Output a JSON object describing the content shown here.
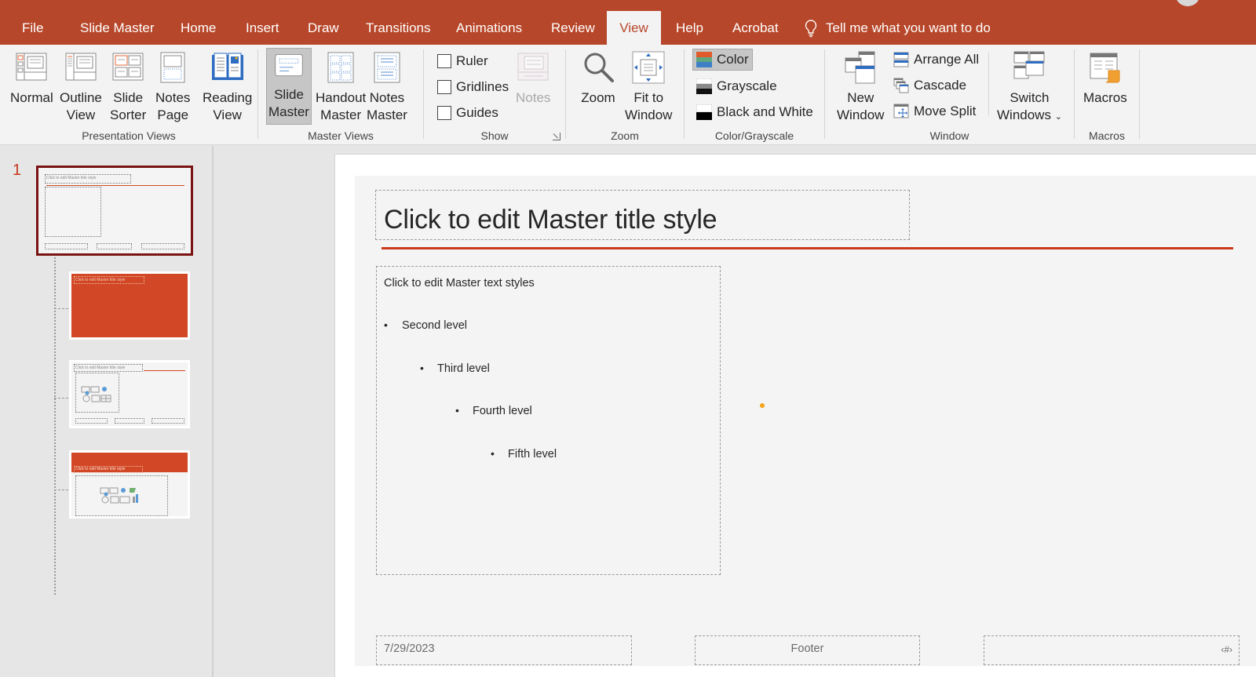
{
  "tabs": [
    {
      "label": "File"
    },
    {
      "label": "Slide Master"
    },
    {
      "label": "Home"
    },
    {
      "label": "Insert"
    },
    {
      "label": "Draw"
    },
    {
      "label": "Transitions"
    },
    {
      "label": "Animations"
    },
    {
      "label": "Review"
    },
    {
      "label": "View",
      "active": true
    },
    {
      "label": "Help"
    },
    {
      "label": "Acrobat"
    }
  ],
  "tell_me": {
    "placeholder": "Tell me what you want to do",
    "icon": "lightbulb-icon"
  },
  "ribbon": {
    "presentation_views": {
      "label": "Presentation Views",
      "buttons": [
        {
          "line1": "Normal",
          "line2": "",
          "icon": "normal-view-icon"
        },
        {
          "line1": "Outline",
          "line2": "View",
          "icon": "outline-view-icon"
        },
        {
          "line1": "Slide",
          "line2": "Sorter",
          "icon": "slide-sorter-icon"
        },
        {
          "line1": "Notes",
          "line2": "Page",
          "icon": "notes-page-icon"
        },
        {
          "line1": "Reading",
          "line2": "View",
          "icon": "reading-view-icon"
        }
      ]
    },
    "master_views": {
      "label": "Master Views",
      "buttons": [
        {
          "line1": "Slide",
          "line2": "Master",
          "icon": "slide-master-icon",
          "selected": true
        },
        {
          "line1": "Handout",
          "line2": "Master",
          "icon": "handout-master-icon"
        },
        {
          "line1": "Notes",
          "line2": "Master",
          "icon": "notes-master-icon"
        }
      ]
    },
    "show": {
      "label": "Show",
      "checkboxes": [
        {
          "label": "Ruler",
          "checked": false
        },
        {
          "label": "Gridlines",
          "checked": false
        },
        {
          "label": "Guides",
          "checked": false
        }
      ],
      "notes_button": {
        "label": "Notes",
        "disabled": true
      }
    },
    "zoom": {
      "label": "Zoom",
      "buttons": [
        {
          "line1": "Zoom",
          "line2": "",
          "icon": "magnifier-icon"
        },
        {
          "line1": "Fit to",
          "line2": "Window",
          "icon": "fit-to-window-icon"
        }
      ]
    },
    "color_grayscale": {
      "label": "Color/Grayscale",
      "options": [
        {
          "label": "Color",
          "selected": true
        },
        {
          "label": "Grayscale",
          "selected": false
        },
        {
          "label": "Black and White",
          "selected": false
        }
      ]
    },
    "window": {
      "label": "Window",
      "new_window": {
        "line1": "New",
        "line2": "Window"
      },
      "small": [
        {
          "label": "Arrange All"
        },
        {
          "label": "Cascade"
        },
        {
          "label": "Move Split"
        }
      ],
      "switch_windows": {
        "line1": "Switch",
        "line2": "Windows",
        "dropdown": "⌄"
      }
    },
    "macros": {
      "label": "Macros",
      "button": {
        "line1": "Macros"
      }
    }
  },
  "thumbnails": {
    "master_number": "1",
    "master_title": "Click to edit Master title style",
    "layout_title": "Click to edit Master title style"
  },
  "slide": {
    "title": "Click to edit Master title style",
    "body": [
      {
        "level": 1,
        "text": "Click to edit Master text styles"
      },
      {
        "level": 2,
        "text": "Second level"
      },
      {
        "level": 3,
        "text": "Third level"
      },
      {
        "level": 4,
        "text": "Fourth level"
      },
      {
        "level": 5,
        "text": "Fifth level"
      }
    ],
    "bullet": "•",
    "date": "7/29/2023",
    "footer": "Footer",
    "slide_number": "‹#›"
  },
  "colors": {
    "accent": "#b7472a",
    "title_rule": "#c93a1a",
    "layout_fill": "#d24726",
    "selection_border": "#7a1313"
  }
}
